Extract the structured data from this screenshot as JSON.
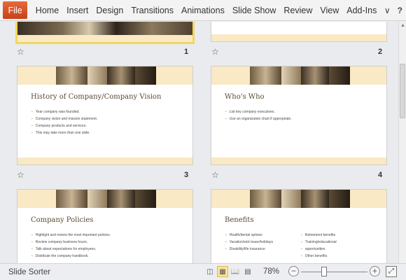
{
  "ribbon": {
    "file_label": "File",
    "tabs": [
      "Home",
      "Insert",
      "Design",
      "Transitions",
      "Animations",
      "Slide Show",
      "Review",
      "View",
      "Add-Ins"
    ],
    "minimize_icon": "chevron-down-icon",
    "help_icon": "help-icon"
  },
  "slides": [
    {
      "number": "1",
      "title": "",
      "bullets": []
    },
    {
      "number": "2",
      "title": "",
      "bullets": []
    },
    {
      "number": "3",
      "title": "History of Company/Company  Vision",
      "bullets": [
        "Year  company was founded.",
        "Company vision and mission statement.",
        "Company products and services.",
        "This may take more  than  one slide."
      ]
    },
    {
      "number": "4",
      "title": "Who's Who",
      "bullets": [
        "List key company executives.",
        "Use  an organization  chart if appropriate."
      ]
    },
    {
      "number": "",
      "title": "Company  Policies",
      "bullets": [
        "Highlight and review  the most important policies.",
        "Review company business hours.",
        "Talk about expectations  for employees.",
        "Distribute the company handbook."
      ]
    },
    {
      "number": "",
      "title": "Benefits",
      "bullets": [
        "Health/dental  options",
        "Vacation/sick leave/holidays",
        "Disability/life insurance"
      ],
      "bullets_col2": [
        "Retirement  benefits",
        "Training/educational",
        "opportunities",
        "Other benefits"
      ]
    }
  ],
  "status": {
    "view_label": "Slide Sorter",
    "zoom": "78%",
    "zoom_out": "−",
    "zoom_in": "+"
  },
  "colors": {
    "accent_band": "#f9e9c4",
    "selection": "#f3d660",
    "file_tab": "#d04a1e"
  }
}
